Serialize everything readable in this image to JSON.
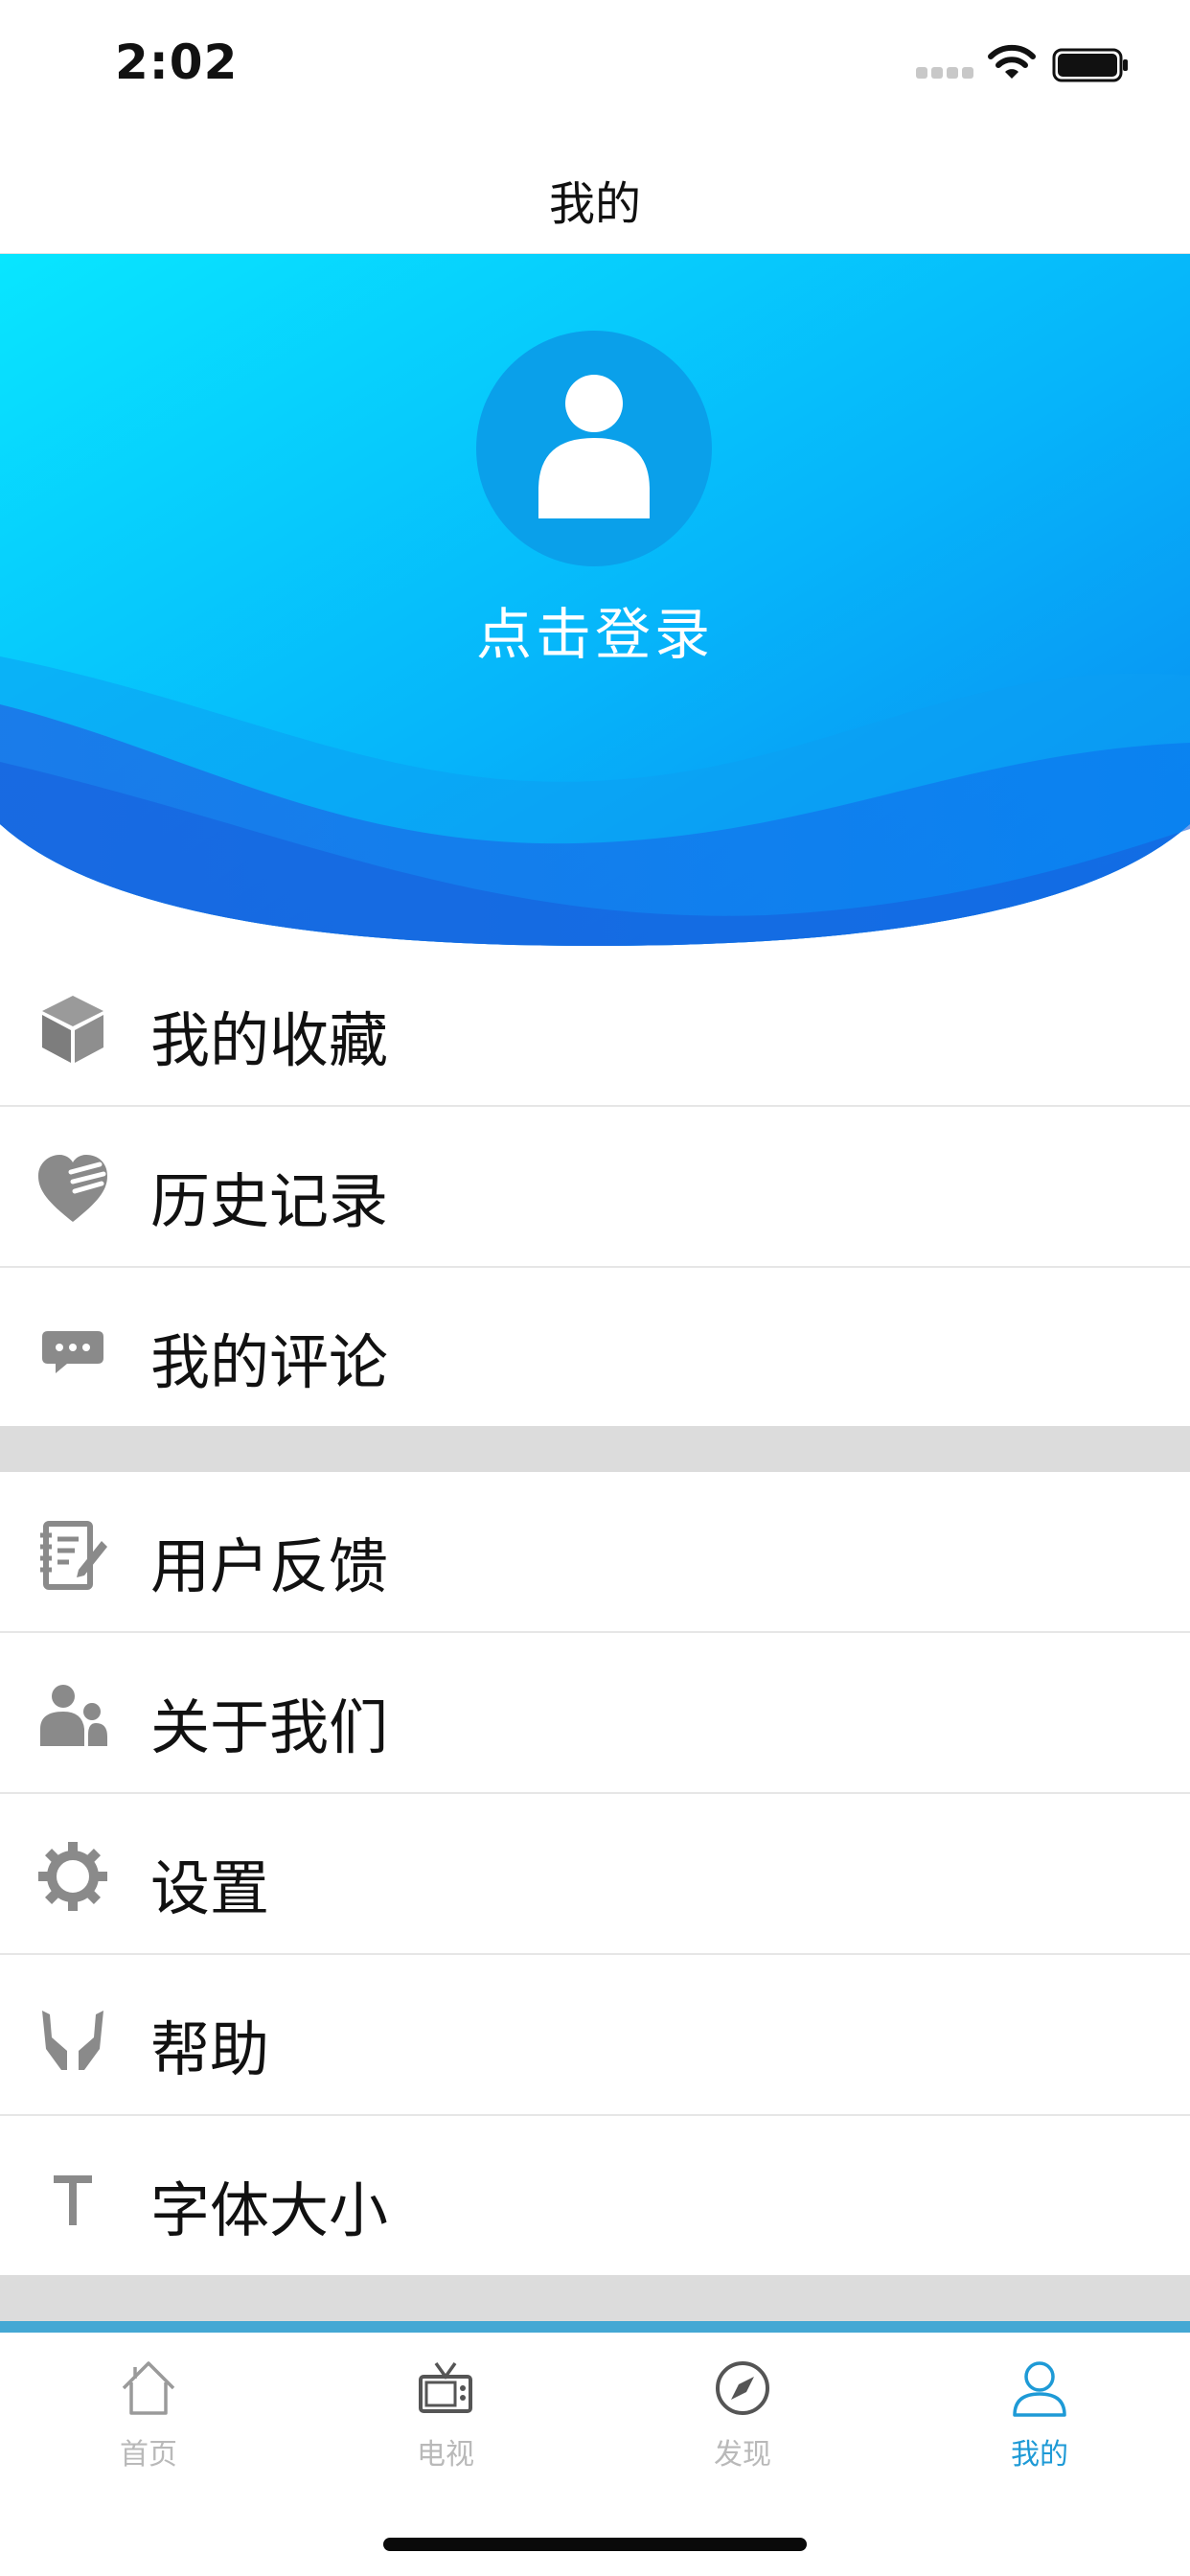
{
  "status_bar": {
    "time": "2:02"
  },
  "nav": {
    "title": "我的"
  },
  "profile": {
    "login_text": "点击登录"
  },
  "menu_group_1": [
    {
      "label": "我的收藏",
      "icon": "box-icon"
    },
    {
      "label": "历史记录",
      "icon": "heart-note-icon"
    },
    {
      "label": "我的评论",
      "icon": "chat-bubble-icon"
    }
  ],
  "menu_group_2": [
    {
      "label": "用户反馈",
      "icon": "notebook-pen-icon"
    },
    {
      "label": "关于我们",
      "icon": "people-icon"
    },
    {
      "label": "设置",
      "icon": "gear-icon"
    },
    {
      "label": "帮助",
      "icon": "hands-icon"
    },
    {
      "label": "字体大小",
      "icon": "text-size-icon"
    }
  ],
  "tabs": [
    {
      "label": "首页",
      "icon": "home-icon",
      "active": false
    },
    {
      "label": "电视",
      "icon": "tv-icon",
      "active": false
    },
    {
      "label": "发现",
      "icon": "compass-icon",
      "active": false
    },
    {
      "label": "我的",
      "icon": "person-icon",
      "active": true
    }
  ],
  "colors": {
    "accent": "#1e9ad6",
    "hero_light": "#08e0ff",
    "hero_dark": "#0a62e0",
    "icon_gray": "#8a8a8a",
    "tab_inactive": "#b9b9b9"
  }
}
